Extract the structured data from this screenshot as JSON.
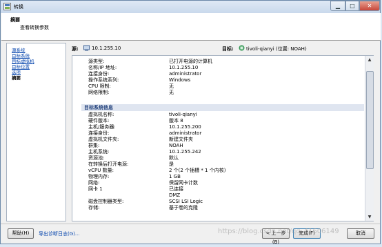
{
  "window": {
    "title": "转换"
  },
  "header": {
    "title": "摘要",
    "subtitle": "查看转换参数"
  },
  "nav": {
    "items": [
      {
        "label": "源系统",
        "current": false
      },
      {
        "label": "目标系统",
        "current": false
      },
      {
        "label": "目标虚拟机",
        "current": false
      },
      {
        "label": "目标位置",
        "current": false
      },
      {
        "label": "选项",
        "current": false
      },
      {
        "label": "摘要",
        "current": true
      }
    ]
  },
  "sourcebar": {
    "source_label": "源:",
    "source_value": "10.1.255.10",
    "target_label": "目标:",
    "target_value": "tivoli-qianyi (位置: NOAH)"
  },
  "source_rows": [
    {
      "key": "源类型:",
      "value": "已打开电源的计算机"
    },
    {
      "key": "名称/IP 地址:",
      "value": "10.1.255.10"
    },
    {
      "key": "连接身份:",
      "value": "administrator"
    },
    {
      "key": "操作系统系列:",
      "value": "Windows"
    },
    {
      "key": "CPU 限制:",
      "value": "无"
    },
    {
      "key": "网络限制:",
      "value": "无"
    }
  ],
  "target_section": {
    "title": "目标系统信息"
  },
  "target_rows": [
    {
      "key": "虚拟机名称:",
      "value": "tivoli-qianyi"
    },
    {
      "key": "硬件版本:",
      "value": "版本 8"
    },
    {
      "key": "主机/服务器:",
      "value": "10.1.255.200"
    },
    {
      "key": "连接身份:",
      "value": "administrator"
    },
    {
      "key": "虚拟机文件夹:",
      "value": "新建文件夹"
    },
    {
      "key": "群集:",
      "value": "NOAH"
    },
    {
      "key": "主机系统:",
      "value": "10.1.255.242"
    },
    {
      "key": "资源池:",
      "value": "默认"
    },
    {
      "key": "在转换后打开电源:",
      "value": "是"
    },
    {
      "key": "vCPU 数量:",
      "value": "2 个(2 个插槽 * 1 个内核)"
    },
    {
      "key": "物理内存:",
      "value": "1 GB"
    },
    {
      "key": "网络:",
      "value": "保留网卡计数"
    },
    {
      "key": "网卡 1",
      "value": "已连接"
    },
    {
      "key": "",
      "value": "DMZ"
    },
    {
      "key": "磁盘控制器类型:",
      "value": "SCSI LSI Logic"
    },
    {
      "key": "存储:",
      "value": "基于卷的克隆"
    }
  ],
  "footer": {
    "help": "帮助(H)",
    "export": "导出诊断日志(G)...",
    "back": "< 上一步(B)",
    "finish": "完成(F)",
    "cancel": "取消"
  },
  "watermark": "https://blog.csdn.net/qq_41606149"
}
